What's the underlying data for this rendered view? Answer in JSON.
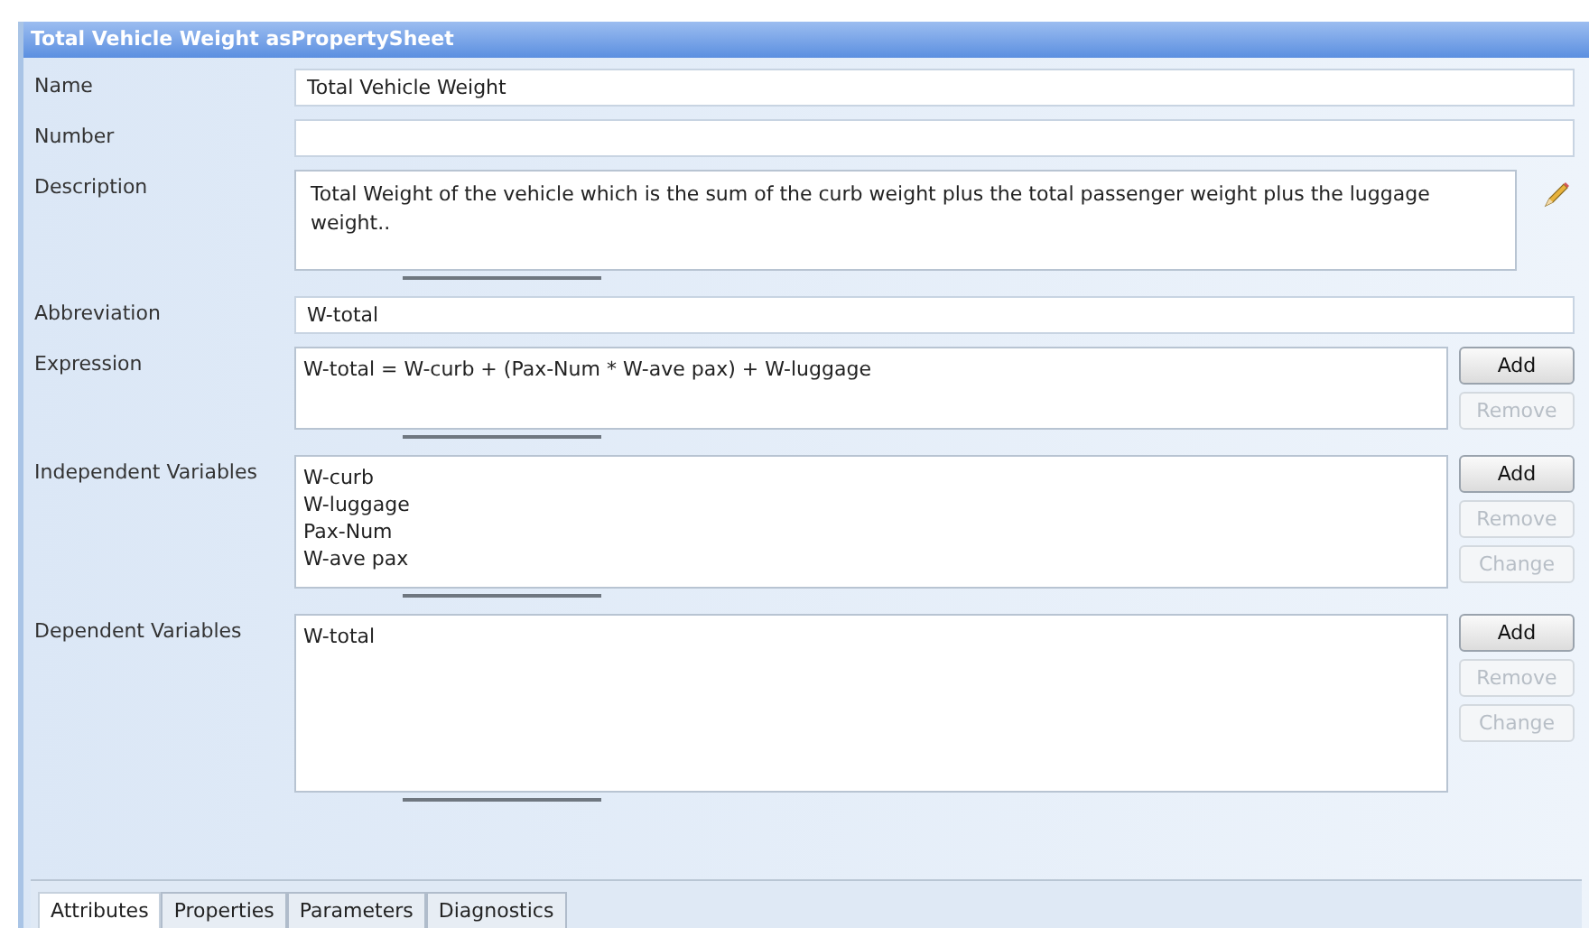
{
  "window": {
    "title": "Total Vehicle Weight asPropertySheet"
  },
  "rows": [
    {
      "kind": "field",
      "label": "Name",
      "value": "Total Vehicle Weight"
    },
    {
      "kind": "field",
      "label": "Number",
      "value": ""
    },
    {
      "kind": "text",
      "label": "Description",
      "value": "Total Weight of the vehicle which is the sum of the curb weight plus the total passenger weight plus the luggage weight..",
      "editable": true
    },
    {
      "kind": "field",
      "label": "Abbreviation",
      "value": "W-total"
    },
    {
      "kind": "list",
      "label": "Expression",
      "items": [
        "W-total = W-curb + (Pax-Num * W-ave pax) + W-luggage"
      ],
      "buttons": [
        {
          "label": "Add",
          "disabled": false
        },
        {
          "label": "Remove",
          "disabled": true
        }
      ]
    },
    {
      "kind": "list",
      "label": "Independent Variables",
      "items": [
        "W-curb",
        "W-luggage",
        "Pax-Num",
        "W-ave pax"
      ],
      "buttons": [
        {
          "label": "Add",
          "disabled": false
        },
        {
          "label": "Remove",
          "disabled": true
        },
        {
          "label": "Change",
          "disabled": true
        }
      ]
    },
    {
      "kind": "list",
      "label": "Dependent Variables",
      "items": [
        "W-total"
      ],
      "buttons": [
        {
          "label": "Add",
          "disabled": false
        },
        {
          "label": "Remove",
          "disabled": true
        },
        {
          "label": "Change",
          "disabled": true
        }
      ]
    }
  ],
  "tabs": [
    {
      "label": "Attributes",
      "selected": true
    },
    {
      "label": "Properties",
      "selected": false
    },
    {
      "label": "Parameters",
      "selected": false
    },
    {
      "label": "Diagnostics",
      "selected": false
    }
  ]
}
